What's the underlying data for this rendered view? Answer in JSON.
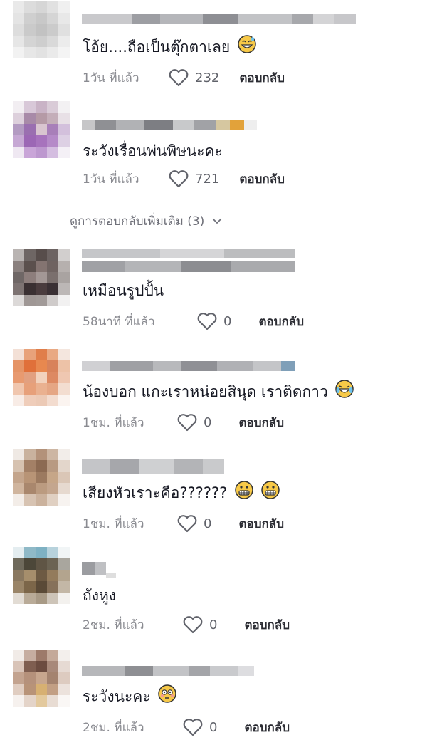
{
  "comments": [
    {
      "text": "โอ้ย....ถือเป็นตุ๊กตาเลย",
      "emoji": "grin-sweat",
      "time": "1วัน ที่แล้ว",
      "likes": "232",
      "reply": "ตอบกลับ"
    },
    {
      "text": "ระวังเรื่อนพ่นพิษนะคะ",
      "emoji": "",
      "time": "1วัน ที่แล้ว",
      "likes": "721",
      "reply": "ตอบกลับ"
    },
    {
      "text": "เหมือนรูปปั้น",
      "emoji": "",
      "time": "58นาที ที่แล้ว",
      "likes": "0",
      "reply": "ตอบกลับ"
    },
    {
      "text": "น้องบอก แกะเราหน่อยสินุด เราติดกาว",
      "emoji": "tears-of-joy",
      "time": "1ชม. ที่แล้ว",
      "likes": "0",
      "reply": "ตอบกลับ"
    },
    {
      "text": "เสียงหัวเราะคือ??????",
      "emoji": "grimace-x2",
      "time": "1ชม. ที่แล้ว",
      "likes": "0",
      "reply": "ตอบกลับ"
    },
    {
      "text": "ถังหูง",
      "emoji": "",
      "time": "2ชม. ที่แล้ว",
      "likes": "0",
      "reply": "ตอบกลับ"
    },
    {
      "text": "ระวังนะคะ",
      "emoji": "flushed",
      "time": "2ชม. ที่แล้ว",
      "likes": "0",
      "reply": "ตอบกลับ"
    }
  ],
  "view_more": {
    "label": "ดูการตอบกลับเพิ่มเติม (3)"
  },
  "colors": {
    "text": "#161823",
    "meta": "#8a8b91",
    "reply": "#2b2c33"
  }
}
